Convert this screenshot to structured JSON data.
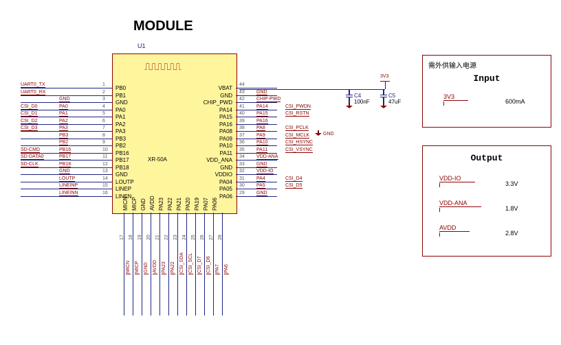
{
  "title": "MODULE",
  "refdes": "U1",
  "chip_name": "XR-50A",
  "left_pins": [
    {
      "num": "1",
      "name": "PB0",
      "net": "UART0_TX",
      "net2": ""
    },
    {
      "num": "2",
      "name": "PB1",
      "net": "UART0_RX",
      "net2": ""
    },
    {
      "num": "3",
      "name": "GND",
      "net": "",
      "net2": "GND"
    },
    {
      "num": "4",
      "name": "PA0",
      "net": "CSI_D0",
      "net2": "PA0"
    },
    {
      "num": "5",
      "name": "PA1",
      "net": "CSI_D1",
      "net2": "PA1"
    },
    {
      "num": "6",
      "name": "PA2",
      "net": "CSI_D2",
      "net2": "PA2"
    },
    {
      "num": "7",
      "name": "PA3",
      "net": "CSI_D3",
      "net2": "PA3"
    },
    {
      "num": "8",
      "name": "PB3",
      "net": "",
      "net2": "PB3"
    },
    {
      "num": "9",
      "name": "PB2",
      "net": "",
      "net2": "PB2"
    },
    {
      "num": "10",
      "name": "PB16",
      "net": "SD-CMD",
      "net2": "PB16"
    },
    {
      "num": "11",
      "name": "PB17",
      "net": "SD-DATA0",
      "net2": "PB17"
    },
    {
      "num": "12",
      "name": "PB18",
      "net": "SD-CLK",
      "net2": "PB18"
    },
    {
      "num": "13",
      "name": "GND",
      "net": "",
      "net2": "GND"
    },
    {
      "num": "14",
      "name": "LOUTP",
      "net": "",
      "net2": "LOUTP"
    },
    {
      "num": "15",
      "name": "LINEP",
      "net": "",
      "net2": "LINEINP"
    },
    {
      "num": "16",
      "name": "LINEN",
      "net": "",
      "net2": "LINEINN"
    }
  ],
  "right_pins": [
    {
      "num": "44",
      "name": "VBAT",
      "net": ""
    },
    {
      "num": "43",
      "name": "GND",
      "net": "GND"
    },
    {
      "num": "42",
      "name": "CHIP_PWD",
      "net": "CHIP-PWD"
    },
    {
      "num": "41",
      "name": "PA14",
      "net": "PA14",
      "net2": "CSI_PWDN"
    },
    {
      "num": "40",
      "name": "PA15",
      "net": "PA15",
      "net2": "CSI_RSTN"
    },
    {
      "num": "39",
      "name": "PA16",
      "net": "PA16",
      "net2": ""
    },
    {
      "num": "38",
      "name": "PA08",
      "net": "PA8",
      "net2": "CSI_PCLK"
    },
    {
      "num": "37",
      "name": "PA09",
      "net": "PA9",
      "net2": "CSI_MCLK"
    },
    {
      "num": "36",
      "name": "PA10",
      "net": "PA10",
      "net2": "CSI_HSYNC"
    },
    {
      "num": "35",
      "name": "PA11",
      "net": "PA11",
      "net2": "CSI_VSYNC"
    },
    {
      "num": "34",
      "name": "VDD_ANA",
      "net": "VDD-ANA"
    },
    {
      "num": "33",
      "name": "GND",
      "net": "GND"
    },
    {
      "num": "32",
      "name": "VDDIO",
      "net": "VDD-IO"
    },
    {
      "num": "31",
      "name": "PA04",
      "net": "PA4",
      "net2": "CSI_D4"
    },
    {
      "num": "30",
      "name": "PA05",
      "net": "PA5",
      "net2": "CSI_D5"
    },
    {
      "num": "29",
      "name": "PA06",
      "net": "GND"
    }
  ],
  "bottom_pins": [
    {
      "num": "17",
      "name": "MICN",
      "net": "MICN"
    },
    {
      "num": "18",
      "name": "MICP",
      "net": "MICP"
    },
    {
      "num": "19",
      "name": "GND",
      "net": "GND"
    },
    {
      "num": "20",
      "name": "AVDD",
      "net": "AVDD"
    },
    {
      "num": "21",
      "name": "PA23",
      "net": "PA23"
    },
    {
      "num": "22",
      "name": "PA22",
      "net": "PA22"
    },
    {
      "num": "23",
      "name": "PA21",
      "net": "CSI_SDA"
    },
    {
      "num": "24",
      "name": "PA20",
      "net": "CSI_SCL"
    },
    {
      "num": "25",
      "name": "PA19",
      "net": "CSI_D7"
    },
    {
      "num": "26",
      "name": "PA07",
      "net": "CSI_D6"
    },
    {
      "num": "27",
      "name": "PA06",
      "net": "PA7"
    },
    {
      "num": "28",
      "name": "",
      "net": "PA6"
    }
  ],
  "caps": [
    {
      "ref": "C4",
      "val": "100nF"
    },
    {
      "ref": "C5",
      "val": "47uF"
    }
  ],
  "rail_3v3": "3V3",
  "gnd_label": "GND",
  "input_box": {
    "header": "需外供输入电源",
    "title": "Input",
    "net": "3V3",
    "val": "600mA"
  },
  "output_box": {
    "title": "Output",
    "rows": [
      {
        "net": "VDD-IO",
        "val": "3.3V"
      },
      {
        "net": "VDD-ANA",
        "val": "1.8V"
      },
      {
        "net": "AVDD",
        "val": "2.8V"
      }
    ]
  }
}
